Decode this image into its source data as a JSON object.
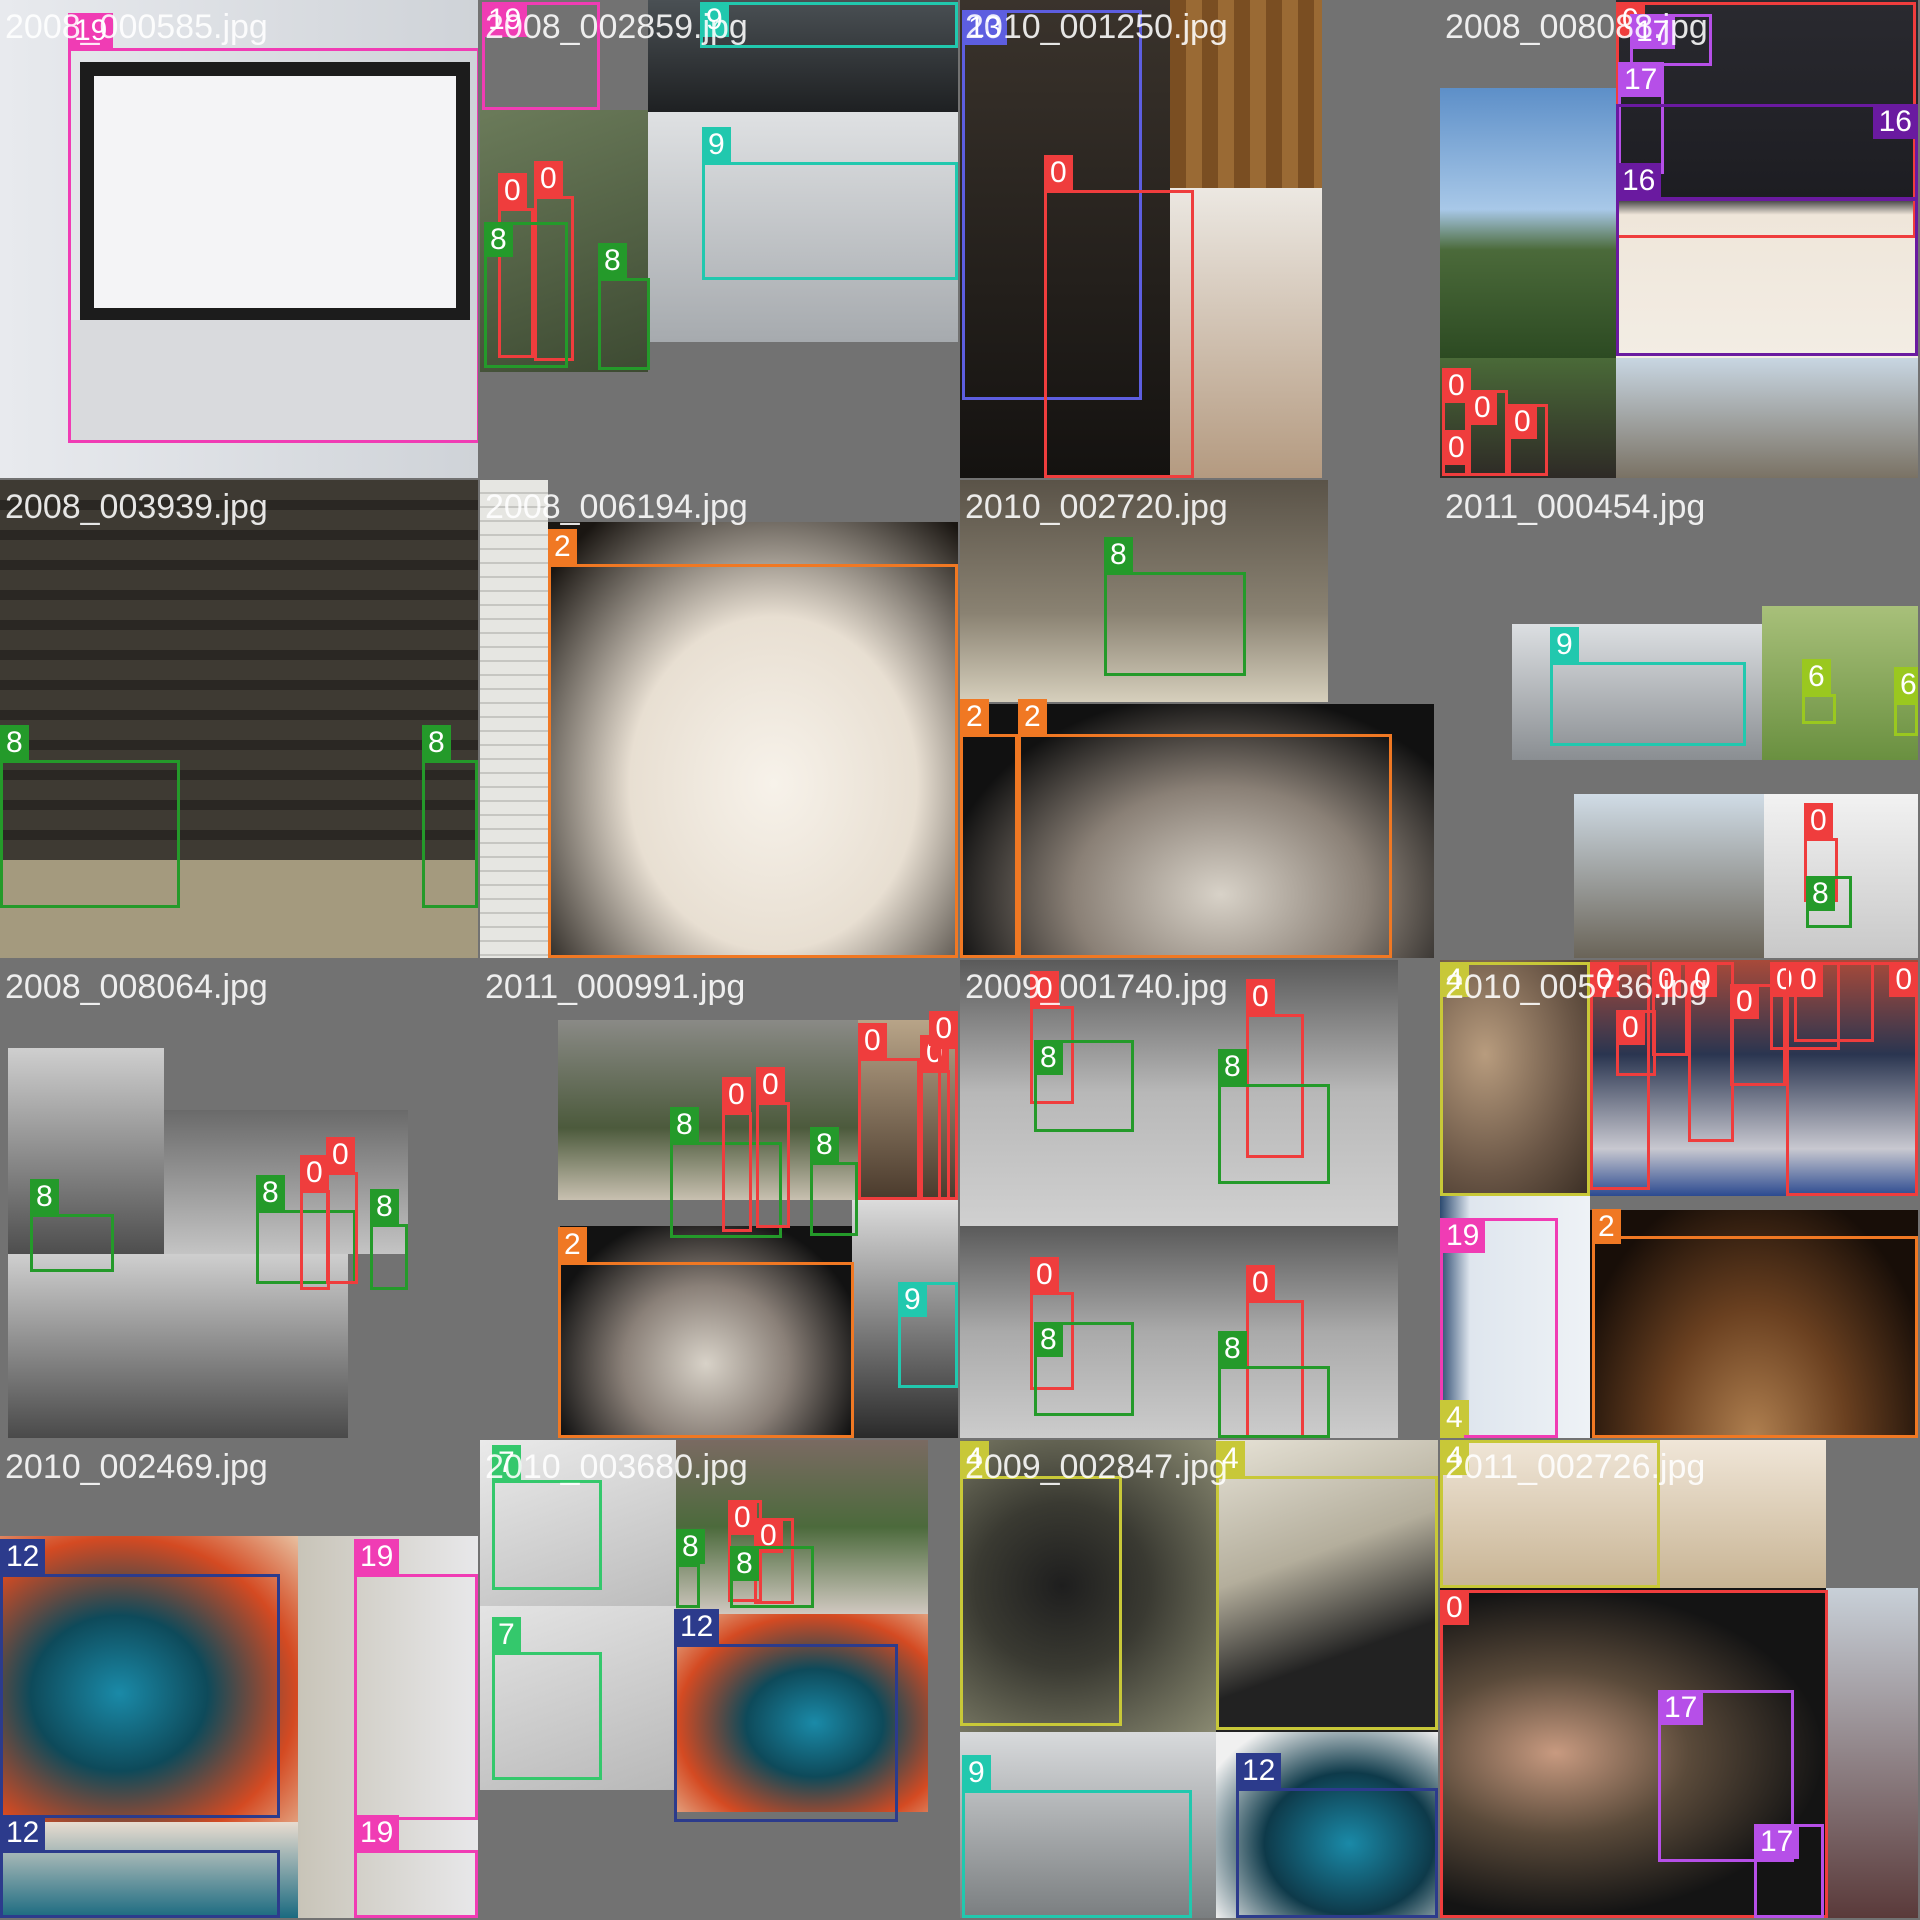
{
  "class_colors": {
    "0": "#ef3d3d",
    "2": "#f07823",
    "4": "#c8c838",
    "6": "#9ac81f",
    "7": "#34c86c",
    "8": "#249a2a",
    "9": "#21c8ae",
    "12": "#2c3b8c",
    "13": "#5d5ee0",
    "16": "#6a1aa0",
    "17": "#b64fe8",
    "19": "#f03cb4"
  },
  "tiles": [
    {
      "title": "2008_000585.jpg",
      "photos": [
        {
          "name": "computer-monitor-photo",
          "bg": "#d8dade"
        },
        {
          "name": "monitor-screen-photo",
          "bg": "#f2f2f4"
        }
      ],
      "boxes": [
        {
          "cls": "19"
        }
      ]
    },
    {
      "title": "2008_002859.jpg",
      "photos": [
        {
          "name": "house-bikes-photo",
          "bg": "#4d5a3f"
        },
        {
          "name": "ship-photo",
          "bg": "#c8cbcf"
        },
        {
          "name": "harbour-photo",
          "bg": "#2a2e30"
        }
      ],
      "boxes": [
        {
          "cls": "19"
        },
        {
          "cls": "9"
        },
        {
          "cls": "0"
        },
        {
          "cls": "0"
        },
        {
          "cls": "8"
        },
        {
          "cls": "8"
        },
        {
          "cls": "9"
        }
      ]
    },
    {
      "title": "2010_001250.jpg",
      "photos": [
        {
          "name": "locomotive-photo",
          "bg": "#2b2622"
        },
        {
          "name": "wood-panel-photo",
          "bg": "#8a5a28"
        },
        {
          "name": "gallery-room-photo",
          "bg": "#c9c0b5"
        }
      ],
      "boxes": [
        {
          "cls": "13"
        },
        {
          "cls": "0"
        }
      ]
    },
    {
      "title": "2008_008088.jpg",
      "photos": [
        {
          "name": "mountain-sky-photo",
          "bg": "#5d8fc8"
        },
        {
          "name": "man-tea-photo",
          "bg": "#1d1d22"
        },
        {
          "name": "people-group-photo",
          "bg": "#3c5a30"
        },
        {
          "name": "temple-photo",
          "bg": "#9ea598"
        }
      ],
      "boxes": [
        {
          "cls": "0"
        },
        {
          "cls": "17"
        },
        {
          "cls": "17"
        },
        {
          "cls": "16"
        },
        {
          "cls": "16"
        },
        {
          "cls": "0"
        },
        {
          "cls": "0"
        },
        {
          "cls": "0"
        },
        {
          "cls": "0"
        }
      ]
    },
    {
      "title": "2008_003939.jpg",
      "photos": [
        {
          "name": "stone-stairs-photo",
          "bg": "#3e3a33"
        }
      ],
      "boxes": [
        {
          "cls": "8"
        },
        {
          "cls": "8"
        }
      ]
    },
    {
      "title": "2008_006194.jpg",
      "photos": [
        {
          "name": "window-blinds-photo",
          "bg": "#dcdcd6"
        },
        {
          "name": "cat-face-photo",
          "bg": "#f3ece0"
        }
      ],
      "boxes": [
        {
          "cls": "2"
        }
      ]
    },
    {
      "title": "2010_002720.jpg",
      "photos": [
        {
          "name": "stairs-bike-photo",
          "bg": "#8f877a"
        },
        {
          "name": "cat-dark-photo",
          "bg": "#1a1715"
        }
      ],
      "boxes": [
        {
          "cls": "8"
        },
        {
          "cls": "2"
        },
        {
          "cls": "2"
        }
      ]
    },
    {
      "title": "2011_000454.jpg",
      "photos": [
        {
          "name": "ship-small-photo",
          "bg": "#c5c9cd"
        },
        {
          "name": "grass-field-photo",
          "bg": "#88a85a"
        },
        {
          "name": "temple-small-photo",
          "bg": "#9a9a90"
        },
        {
          "name": "man-bike-small-photo",
          "bg": "#e0e0e0"
        }
      ],
      "boxes": [
        {
          "cls": "9"
        },
        {
          "cls": "6"
        },
        {
          "cls": "6"
        },
        {
          "cls": "0"
        },
        {
          "cls": "8"
        }
      ]
    },
    {
      "title": "2008_008064.jpg",
      "photos": [
        {
          "name": "temple-grey-photo",
          "bg": "#5c5c5c"
        },
        {
          "name": "house-bw-photo",
          "bg": "#9a9a9a"
        },
        {
          "name": "temple-grey-2-photo",
          "bg": "#5a5a5a"
        },
        {
          "name": "temple-grey-3-photo",
          "bg": "#5a5a5a"
        }
      ],
      "boxes": [
        {
          "cls": "8"
        },
        {
          "cls": "8"
        },
        {
          "cls": "0"
        },
        {
          "cls": "0"
        },
        {
          "cls": "8"
        }
      ]
    },
    {
      "title": "2011_000991.jpg",
      "photos": [
        {
          "name": "house-bikes-2-photo",
          "bg": "#4c5a3c"
        },
        {
          "name": "crowd-photo",
          "bg": "#7b6a55"
        },
        {
          "name": "cat-face-2-photo",
          "bg": "#1b1816"
        },
        {
          "name": "ship-partial-photo",
          "bg": "#c8c8c8"
        }
      ],
      "boxes": [
        {
          "cls": "8"
        },
        {
          "cls": "0"
        },
        {
          "cls": "0"
        },
        {
          "cls": "8"
        },
        {
          "cls": "0"
        },
        {
          "cls": "0"
        },
        {
          "cls": "0"
        },
        {
          "cls": "2"
        },
        {
          "cls": "9"
        }
      ]
    },
    {
      "title": "2009_001740.jpg",
      "photos": [
        {
          "name": "gas-station-bw-photo",
          "bg": "#a8a8a8"
        },
        {
          "name": "gas-station-bw-2-photo",
          "bg": "#a0a0a0"
        }
      ],
      "boxes": [
        {
          "cls": "0"
        },
        {
          "cls": "8"
        },
        {
          "cls": "0"
        },
        {
          "cls": "8"
        },
        {
          "cls": "0"
        },
        {
          "cls": "8"
        },
        {
          "cls": "0"
        },
        {
          "cls": "8"
        }
      ]
    },
    {
      "title": "2010_005736.jpg",
      "photos": [
        {
          "name": "cat-fur-photo",
          "bg": "#7a6a5a"
        },
        {
          "name": "kids-party-photo",
          "bg": "#2a3550"
        },
        {
          "name": "laptop-screen-photo",
          "bg": "#5a7898"
        },
        {
          "name": "cat-orange-photo",
          "bg": "#24150c"
        }
      ],
      "boxes": [
        {
          "cls": "4"
        },
        {
          "cls": "0"
        },
        {
          "cls": "0"
        },
        {
          "cls": "0"
        },
        {
          "cls": "0"
        },
        {
          "cls": "0"
        },
        {
          "cls": "0"
        },
        {
          "cls": "0"
        },
        {
          "cls": "0"
        },
        {
          "cls": "19"
        },
        {
          "cls": "2"
        },
        {
          "cls": "4"
        }
      ]
    },
    {
      "title": "2010_002469.jpg",
      "photos": [
        {
          "name": "motorcycle-photo",
          "bg": "#d0642a"
        },
        {
          "name": "monitor-side-photo",
          "bg": "#d8d6d0"
        },
        {
          "name": "motorcycle-2-photo",
          "bg": "#d0642a"
        }
      ],
      "boxes": [
        {
          "cls": "12"
        },
        {
          "cls": "19"
        },
        {
          "cls": "12"
        },
        {
          "cls": "19"
        }
      ]
    },
    {
      "title": "2010_003680.jpg",
      "photos": [
        {
          "name": "airplane-photo",
          "bg": "#d8d8d8"
        },
        {
          "name": "airplane-2-photo",
          "bg": "#d0d0d0"
        },
        {
          "name": "house-bikes-3-photo",
          "bg": "#4c6a3c"
        },
        {
          "name": "motorcycle-3-photo",
          "bg": "#d46a2c"
        }
      ],
      "boxes": [
        {
          "cls": "7"
        },
        {
          "cls": "0"
        },
        {
          "cls": "0"
        },
        {
          "cls": "8"
        },
        {
          "cls": "8"
        },
        {
          "cls": "7"
        },
        {
          "cls": "12"
        }
      ]
    },
    {
      "title": "2009_002847.jpg",
      "photos": [
        {
          "name": "dog-grass-photo",
          "bg": "#6a6a58"
        },
        {
          "name": "dog-bench-photo",
          "bg": "#c8c4b4"
        },
        {
          "name": "ship-bw-photo",
          "bg": "#b4b8ba"
        },
        {
          "name": "motorcycle-4-photo",
          "bg": "#1a2a3a"
        }
      ],
      "boxes": [
        {
          "cls": "4"
        },
        {
          "cls": "4"
        },
        {
          "cls": "9"
        },
        {
          "cls": "12"
        }
      ]
    },
    {
      "title": "2011_002726.jpg",
      "photos": [
        {
          "name": "stones-photo",
          "bg": "#e0d5c4"
        },
        {
          "name": "man-sunglasses-photo",
          "bg": "#1e1a18"
        },
        {
          "name": "street-photo",
          "bg": "#8a6a6a"
        }
      ],
      "boxes": [
        {
          "cls": "4"
        },
        {
          "cls": "0"
        },
        {
          "cls": "17"
        },
        {
          "cls": "17"
        }
      ]
    }
  ]
}
